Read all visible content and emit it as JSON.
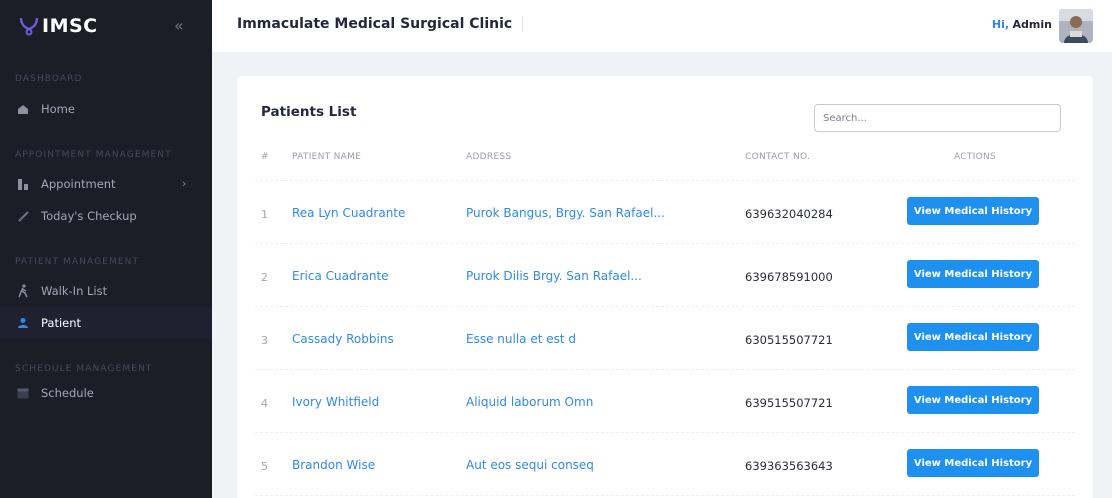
{
  "sidebar": {
    "brand": "IMSC",
    "sections": [
      {
        "label": "DASHBOARD",
        "items": [
          {
            "label": "Home",
            "icon": "home-icon"
          }
        ]
      },
      {
        "label": "APPOINTMENT MANAGEMENT",
        "items": [
          {
            "label": "Appointment",
            "icon": "appointment-icon"
          },
          {
            "label": "Today's Checkup",
            "icon": "checkup-icon"
          }
        ]
      },
      {
        "label": "PATIENT MANAGEMENT",
        "items": [
          {
            "label": "Walk-In List",
            "icon": "walk-icon"
          },
          {
            "label": "Patient",
            "icon": "user-icon"
          }
        ]
      },
      {
        "label": "SCHEDULE MANAGEMENT",
        "items": [
          {
            "label": "Schedule",
            "icon": "calendar-icon"
          }
        ]
      }
    ]
  },
  "header": {
    "title": "Immaculate Medical Surgical Clinic",
    "greeting_hi": "Hi,",
    "greeting_name": "Admin"
  },
  "card": {
    "title": "Patients List",
    "search_placeholder": "Search...",
    "columns": [
      "#",
      "PATIENT NAME",
      "ADDRESS",
      "CONTACT NO.",
      "ACTIONS"
    ],
    "rows": [
      {
        "num": "1",
        "name": "Rea Lyn Cuadrante",
        "address": "Purok Bangus, Brgy. San Rafael...",
        "contact": "639632040284",
        "action": "View Medical History"
      },
      {
        "num": "2",
        "name": "Erica Cuadrante",
        "address": "Purok Dilis Brgy. San Rafael...",
        "contact": "639678591000",
        "action": "View Medical History"
      },
      {
        "num": "3",
        "name": "Cassady Robbins",
        "address": "Esse nulla et est d",
        "contact": "630515507721",
        "action": "View Medical History"
      },
      {
        "num": "4",
        "name": "Ivory Whitfield",
        "address": "Aliquid laborum Omn",
        "contact": "639515507721",
        "action": "View Medical History"
      },
      {
        "num": "5",
        "name": "Brandon Wise",
        "address": "Aut eos sequi conseq",
        "contact": "639363563643",
        "action": "View Medical History"
      }
    ]
  },
  "colors": {
    "sidebar_bg": "#1b1d27",
    "accent": "#1e90f0",
    "link": "#2f8ae6"
  }
}
